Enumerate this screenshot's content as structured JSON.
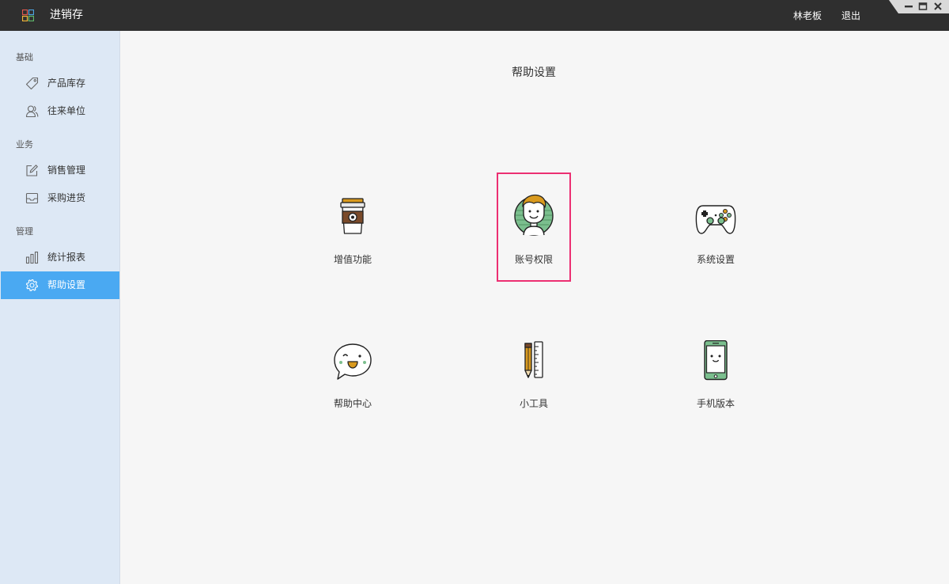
{
  "window": {
    "title": "进销存",
    "user": "林老板",
    "logout": "退出"
  },
  "sidebar": {
    "sections": [
      {
        "label": "基础",
        "items": [
          {
            "label": "产品库存",
            "icon": "tag-icon"
          },
          {
            "label": "往来单位",
            "icon": "users-icon"
          }
        ]
      },
      {
        "label": "业务",
        "items": [
          {
            "label": "销售管理",
            "icon": "edit-icon"
          },
          {
            "label": "采购进货",
            "icon": "inbox-icon"
          }
        ]
      },
      {
        "label": "管理",
        "items": [
          {
            "label": "统计报表",
            "icon": "bar-chart-icon"
          },
          {
            "label": "帮助设置",
            "icon": "gear-icon",
            "active": true
          }
        ]
      }
    ]
  },
  "main": {
    "title": "帮助设置",
    "tiles": [
      {
        "label": "增值功能",
        "icon": "coffee-cup-icon"
      },
      {
        "label": "账号权限",
        "icon": "user-avatar-icon",
        "highlighted": true
      },
      {
        "label": "系统设置",
        "icon": "gamepad-icon"
      },
      {
        "label": "帮助中心",
        "icon": "chat-bubble-icon"
      },
      {
        "label": "小工具",
        "icon": "pencil-ruler-icon"
      },
      {
        "label": "手机版本",
        "icon": "mobile-phone-icon"
      }
    ]
  },
  "colors": {
    "titlebar": "#2f2f2f",
    "sidebar": "#dde8f5",
    "active_item": "#4aa9f2",
    "highlight": "#ec2f72",
    "icon_green": "#7bbf8e",
    "icon_brown": "#7a4a2a",
    "icon_gold": "#d99a1e"
  }
}
